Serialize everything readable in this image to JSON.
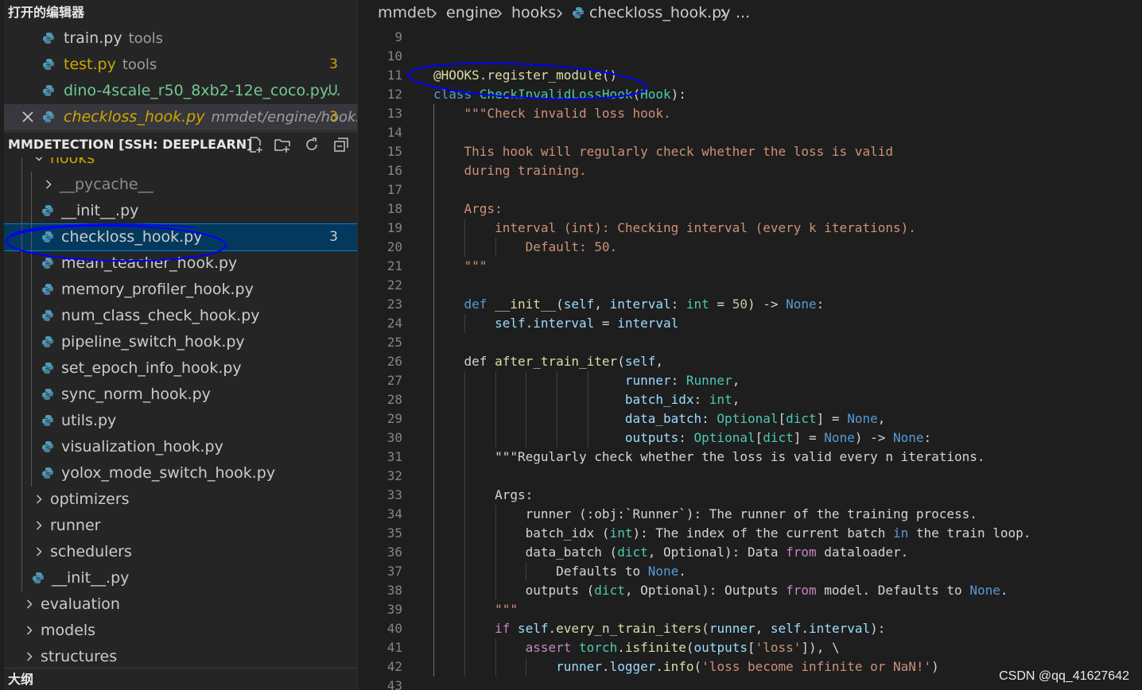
{
  "sidebar": {
    "open_editors_title": "打开的编辑器",
    "open_editors": [
      {
        "name": "train.py",
        "desc": "tools",
        "badge": "",
        "color": "#cccccc",
        "italic": false
      },
      {
        "name": "test.py",
        "desc": "tools",
        "badge": "3",
        "color": "#cca700",
        "italic": false
      },
      {
        "name": "dino-4scale_r50_8xb2-12e_coco.py...",
        "desc": "",
        "badge": "U",
        "color": "#73c991",
        "italic": false
      },
      {
        "name": "checkloss_hook.py",
        "desc": "mmdet/engine/hooks",
        "badge": "3",
        "color": "#cca700",
        "italic": true
      }
    ],
    "explorer_title": "MMDETECTION [SSH: DEEPLEARN]",
    "explorer_actions": [
      "new-file-icon",
      "new-folder-icon",
      "refresh-icon",
      "collapse-all-icon"
    ],
    "tree": [
      {
        "label": "hooks",
        "type": "folder-open"
      },
      {
        "label": "__pycache__",
        "type": "folder"
      },
      {
        "label": "__init__.py",
        "type": "file"
      },
      {
        "label": "checkloss_hook.py",
        "type": "file",
        "badge": "3",
        "active": true
      },
      {
        "label": "mean_teacher_hook.py",
        "type": "file"
      },
      {
        "label": "memory_profiler_hook.py",
        "type": "file"
      },
      {
        "label": "num_class_check_hook.py",
        "type": "file"
      },
      {
        "label": "pipeline_switch_hook.py",
        "type": "file"
      },
      {
        "label": "set_epoch_info_hook.py",
        "type": "file"
      },
      {
        "label": "sync_norm_hook.py",
        "type": "file"
      },
      {
        "label": "utils.py",
        "type": "file"
      },
      {
        "label": "visualization_hook.py",
        "type": "file"
      },
      {
        "label": "yolox_mode_switch_hook.py",
        "type": "file"
      },
      {
        "label": "optimizers",
        "type": "folder"
      },
      {
        "label": "runner",
        "type": "folder"
      },
      {
        "label": "schedulers",
        "type": "folder"
      },
      {
        "label": "__init__.py",
        "type": "file"
      },
      {
        "label": "evaluation",
        "type": "folder"
      },
      {
        "label": "models",
        "type": "folder"
      },
      {
        "label": "structures",
        "type": "folder"
      }
    ],
    "outline_title": "大纲"
  },
  "editor": {
    "breadcrumb": [
      "mmdet",
      "engine",
      "hooks",
      "checkloss_hook.py",
      "..."
    ],
    "line_numbers": [
      "9",
      "10",
      "11",
      "12",
      "13",
      "14",
      "15",
      "16",
      "17",
      "18",
      "19",
      "20",
      "21",
      "22",
      "23",
      "24",
      "25",
      "26",
      "27",
      "28",
      "29",
      "30",
      "31",
      "32",
      "33",
      "34",
      "35",
      "36",
      "37",
      "38",
      "39",
      "40",
      "41",
      "42",
      "43"
    ],
    "lines": [
      [],
      [],
      [
        [
          "@HOOKS",
          "dec"
        ],
        [
          ".register_module",
          "fn"
        ],
        [
          "()",
          "pl"
        ]
      ],
      [
        [
          "class ",
          "def"
        ],
        [
          "CheckInvalidLossHook",
          "cls"
        ],
        [
          "(",
          "pl"
        ],
        [
          "Hook",
          "cls"
        ],
        [
          "):",
          "pl"
        ]
      ],
      [
        [
          "    \"\"\"Check invalid loss hook.",
          "str"
        ]
      ],
      [],
      [
        [
          "    This hook will regularly check whether the loss is valid",
          "str"
        ]
      ],
      [
        [
          "    during training.",
          "str"
        ]
      ],
      [],
      [
        [
          "    Args:",
          "str"
        ]
      ],
      [
        [
          "        interval (int): Checking interval (every k iterations).",
          "str"
        ]
      ],
      [
        [
          "            Default: 50.",
          "str"
        ]
      ],
      [
        [
          "    \"\"\"",
          "str"
        ]
      ],
      [],
      [
        [
          "    ",
          "pl"
        ],
        [
          "def ",
          "def"
        ],
        [
          "__init__",
          "fn"
        ],
        [
          "(",
          "pl"
        ],
        [
          "self",
          "var"
        ],
        [
          ", ",
          "pl"
        ],
        [
          "interval",
          "var"
        ],
        [
          ": ",
          "pl"
        ],
        [
          "int",
          "cls"
        ],
        [
          " = ",
          "pl"
        ],
        [
          "50",
          "num"
        ],
        [
          ") -> ",
          "pl"
        ],
        [
          "None",
          "def"
        ],
        [
          ":",
          "pl"
        ]
      ],
      [
        [
          "        ",
          "pl"
        ],
        [
          "self",
          "var"
        ],
        [
          ".",
          "pl"
        ],
        [
          "interval",
          "var"
        ],
        [
          " = ",
          "pl"
        ],
        [
          "interval",
          "var"
        ]
      ],
      [],
      [
        [
          "    def ",
          "pl"
        ],
        [
          "after_train_iter",
          "fn"
        ],
        [
          "(",
          "pl"
        ],
        [
          "self",
          "var"
        ],
        [
          ",",
          "pl"
        ]
      ],
      [
        [
          "                         ",
          "pl"
        ],
        [
          "runner",
          "var"
        ],
        [
          ": ",
          "pl"
        ],
        [
          "Runner",
          "cls"
        ],
        [
          ",",
          "pl"
        ]
      ],
      [
        [
          "                         ",
          "pl"
        ],
        [
          "batch_idx",
          "var"
        ],
        [
          ": ",
          "pl"
        ],
        [
          "int",
          "cls"
        ],
        [
          ",",
          "pl"
        ]
      ],
      [
        [
          "                         ",
          "pl"
        ],
        [
          "data_batch",
          "var"
        ],
        [
          ": ",
          "pl"
        ],
        [
          "Optional",
          "cls"
        ],
        [
          "[",
          "pl"
        ],
        [
          "dict",
          "cls"
        ],
        [
          "] = ",
          "pl"
        ],
        [
          "None",
          "def"
        ],
        [
          ",",
          "pl"
        ]
      ],
      [
        [
          "                         ",
          "pl"
        ],
        [
          "outputs",
          "var"
        ],
        [
          ": ",
          "pl"
        ],
        [
          "Optional",
          "cls"
        ],
        [
          "[",
          "pl"
        ],
        [
          "dict",
          "cls"
        ],
        [
          "] = ",
          "pl"
        ],
        [
          "None",
          "def"
        ],
        [
          ") -> ",
          "pl"
        ],
        [
          "None",
          "def"
        ],
        [
          ":",
          "pl"
        ]
      ],
      [
        [
          "        \"\"\"Regularly check whether the loss is valid every n iterations.",
          "pl"
        ]
      ],
      [],
      [
        [
          "        Args:",
          "pl"
        ]
      ],
      [
        [
          "            runner (:obj:`Runner`): The runner of the training process.",
          "pl"
        ]
      ],
      [
        [
          "            batch_idx (",
          "pl"
        ],
        [
          "int",
          "cls"
        ],
        [
          "): The index of the current batch ",
          "pl"
        ],
        [
          "in",
          "def"
        ],
        [
          " the train loop.",
          "pl"
        ]
      ],
      [
        [
          "            data_batch (",
          "pl"
        ],
        [
          "dict",
          "cls"
        ],
        [
          ", Optional): Data ",
          "pl"
        ],
        [
          "from",
          "ctl"
        ],
        [
          " dataloader.",
          "pl"
        ]
      ],
      [
        [
          "                Defaults to ",
          "pl"
        ],
        [
          "None",
          "def"
        ],
        [
          ".",
          "pl"
        ]
      ],
      [
        [
          "            outputs (",
          "pl"
        ],
        [
          "dict",
          "cls"
        ],
        [
          ", Optional): Outputs ",
          "pl"
        ],
        [
          "from",
          "ctl"
        ],
        [
          " model. Defaults to ",
          "pl"
        ],
        [
          "None",
          "def"
        ],
        [
          ".",
          "pl"
        ]
      ],
      [
        [
          "        \"\"\"",
          "str"
        ]
      ],
      [
        [
          "        ",
          "pl"
        ],
        [
          "if ",
          "ctl"
        ],
        [
          "self",
          "var"
        ],
        [
          ".",
          "pl"
        ],
        [
          "every_n_train_iters",
          "fn"
        ],
        [
          "(",
          "pl"
        ],
        [
          "runner",
          "var"
        ],
        [
          ", ",
          "pl"
        ],
        [
          "self",
          "var"
        ],
        [
          ".",
          "pl"
        ],
        [
          "interval",
          "var"
        ],
        [
          "):",
          "pl"
        ]
      ],
      [
        [
          "            ",
          "pl"
        ],
        [
          "assert ",
          "ctl"
        ],
        [
          "torch",
          "cls"
        ],
        [
          ".",
          "pl"
        ],
        [
          "isfinite",
          "fn"
        ],
        [
          "(",
          "pl"
        ],
        [
          "outputs",
          "var"
        ],
        [
          "[",
          "pl"
        ],
        [
          "'loss'",
          "str"
        ],
        [
          "]), \\",
          "pl"
        ]
      ],
      [
        [
          "                ",
          "pl"
        ],
        [
          "runner",
          "var"
        ],
        [
          ".",
          "pl"
        ],
        [
          "logger",
          "var"
        ],
        [
          ".",
          "pl"
        ],
        [
          "info",
          "fn"
        ],
        [
          "(",
          "pl"
        ],
        [
          "'loss become infinite or NaN!'",
          "str"
        ],
        [
          ")",
          "pl"
        ]
      ],
      []
    ]
  },
  "watermark": "CSDN @qq_41627642",
  "colors": {
    "editor_bg": "#1e1e1e",
    "sidebar_bg": "#252526",
    "selection_bg": "#04395e",
    "annotation_circle": "#0000ff",
    "warning": "#cca700",
    "untracked": "#73c991"
  }
}
